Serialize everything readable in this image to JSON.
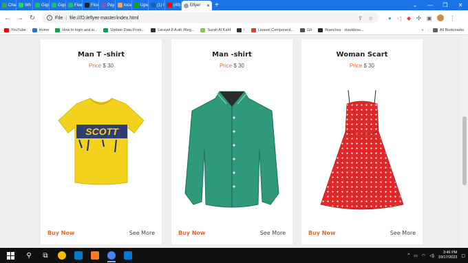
{
  "browser": {
    "tabs": [
      {
        "label": "Cha",
        "color": "#34a853"
      },
      {
        "label": "Wh",
        "color": "#25d366"
      },
      {
        "label": "Gigs",
        "color": "#1dbf73"
      },
      {
        "label": "Gigs",
        "color": "#1dbf73"
      },
      {
        "label": "Five",
        "color": "#1dbf73"
      },
      {
        "label": "Flov",
        "color": "#222222"
      },
      {
        "label": "Pay",
        "color": "#7e57c2"
      },
      {
        "label": "loca",
        "color": "#f4a261"
      },
      {
        "label": "Upw",
        "color": "#14a800"
      },
      {
        "label": "(1) I",
        "color": "#0a66c2"
      },
      {
        "label": "(49)",
        "color": "#ff0000"
      }
    ],
    "active_tab": {
      "label": "Eflyer"
    },
    "new_tab_label": "+",
    "window_controls": [
      "⌄",
      "—",
      "❐",
      "✕"
    ],
    "address": {
      "scheme_label": "File",
      "url": "file:///D:/eflyer-master/index.html"
    },
    "bookmarks": [
      {
        "label": "YouTube",
        "color": "#ff0000"
      },
      {
        "label": "Home",
        "color": "#1877f2"
      },
      {
        "label": "How to login and si...",
        "color": "#0f9d58"
      },
      {
        "label": "Update Data From...",
        "color": "#0f9d58"
      },
      {
        "label": "Laravel 8 Auth (Reg...",
        "color": "#333333"
      },
      {
        "label": "Surah Al Kahf",
        "color": "#8bc34a"
      },
      {
        "label": "\\",
        "color": "#333333"
      },
      {
        "label": "Laravel Component...",
        "color": "#e53935"
      },
      {
        "label": "Git",
        "color": "#555555"
      },
      {
        "label": "Branches · stackbras...",
        "color": "#24292e"
      }
    ],
    "bookmarks_overflow": "»",
    "all_bookmarks_label": "All Bookmarks"
  },
  "products": [
    {
      "name": "Man T -shirt",
      "price_label": "Price",
      "price": "$ 30",
      "image": "yellow-tshirt-scott",
      "buy_label": "Buy Now",
      "more_label": "See More"
    },
    {
      "name": "Man -shirt",
      "price_label": "Price",
      "price": "$ 30",
      "image": "green-dress-shirt",
      "buy_label": "Buy Now",
      "more_label": "See More"
    },
    {
      "name": "Woman Scart",
      "price_label": "Price",
      "price": "$ 30",
      "image": "red-polka-dot-dress",
      "buy_label": "Buy Now",
      "more_label": "See More"
    }
  ],
  "tshirt_print": "SCOTT",
  "taskbar": {
    "apps": [
      {
        "name": "chrome",
        "color": "#fbbc05"
      },
      {
        "name": "vscode",
        "color": "#007acc"
      },
      {
        "name": "xampp",
        "color": "#fb7a24"
      },
      {
        "name": "chrome-profile",
        "color": "#4285f4"
      },
      {
        "name": "mail",
        "color": "#0078d4"
      }
    ],
    "time": "3:46 PM",
    "date": "10/17/2023",
    "tray_expand": "^"
  }
}
